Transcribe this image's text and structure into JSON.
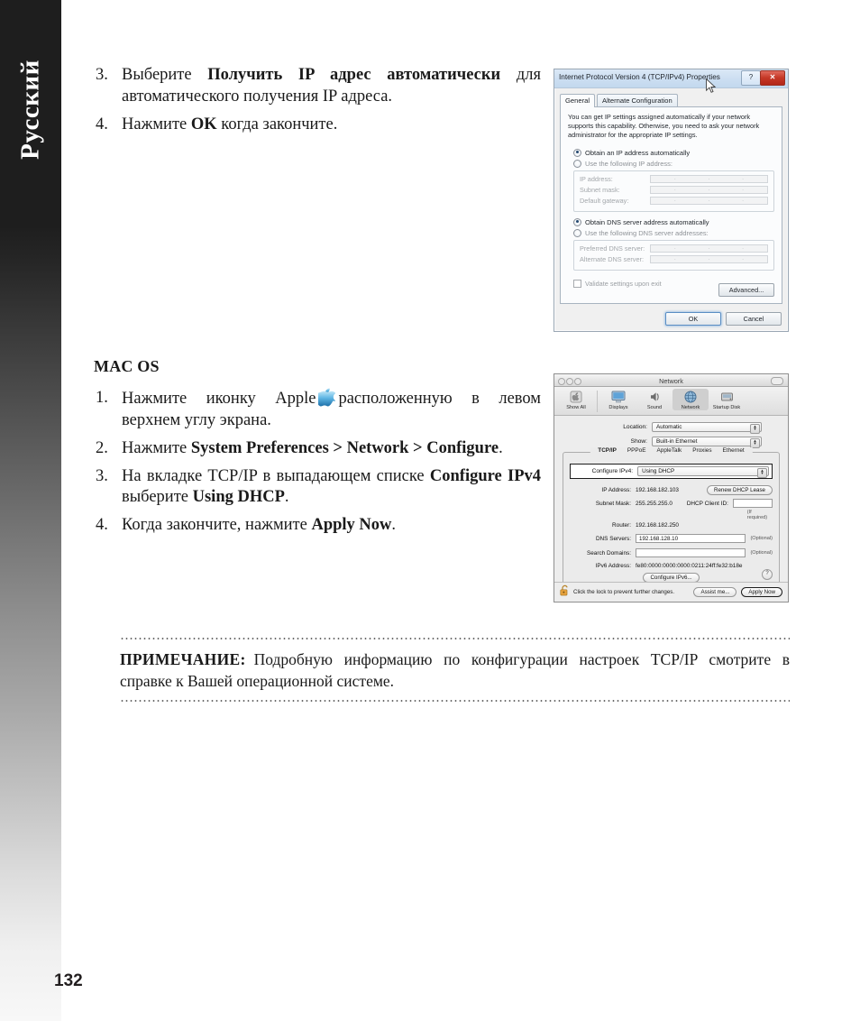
{
  "sidebar": {
    "language_label": "Русский"
  },
  "page": {
    "number": "132"
  },
  "windows_steps": [
    {
      "num": "3.",
      "text_before": "Выберите ",
      "bold": "Получить IP адрес автоматически",
      "text_after": " для автоматического получения IP адреса."
    },
    {
      "num": "4.",
      "text_before": "Нажмите ",
      "bold": "OK",
      "text_after": " когда закончите."
    }
  ],
  "mac_section": {
    "heading": "MAC OS",
    "steps": [
      {
        "num": "1.",
        "part1": "Нажмите иконку Apple",
        "icon": "apple-icon",
        "part2": "расположенную в левом верхнем углу экрана."
      },
      {
        "num": "2.",
        "part1": "Нажмите ",
        "bold": "System Preferences > Network > Configure",
        "part2": "."
      },
      {
        "num": "3.",
        "part1": "На вкладке TCP/IP в выпадающем списке ",
        "bold": "Configure IPv4",
        "part2": " выберите ",
        "bold2": "Using DHCP",
        "part3": "."
      },
      {
        "num": "4.",
        "part1": "Когда закончите, нажмите ",
        "bold": "Apply Now",
        "part2": "."
      }
    ]
  },
  "note": {
    "lead": "ПРИМЕЧАНИЕ:",
    "body": "Подробную информацию по конфигурации настроек TCP/IP смотрите в справке к Вашей операционной системе."
  },
  "windows_dialog": {
    "title": "Internet Protocol Version 4 (TCP/IPv4) Properties",
    "help_button": "?",
    "close_button": "✕",
    "tabs": [
      {
        "label": "General",
        "active": true
      },
      {
        "label": "Alternate Configuration",
        "active": false
      }
    ],
    "intro": "You can get IP settings assigned automatically if your network supports this capability. Otherwise, you need to ask your network administrator for the appropriate IP settings.",
    "radio_obtain_ip": "Obtain an IP address automatically",
    "radio_use_ip": "Use the following IP address:",
    "ip_fields": [
      {
        "label": "IP address:",
        "value": ""
      },
      {
        "label": "Subnet mask:",
        "value": ""
      },
      {
        "label": "Default gateway:",
        "value": ""
      }
    ],
    "radio_obtain_dns": "Obtain DNS server address automatically",
    "radio_use_dns": "Use the following DNS server addresses:",
    "dns_fields": [
      {
        "label": "Preferred DNS server:",
        "value": ""
      },
      {
        "label": "Alternate DNS server:",
        "value": ""
      }
    ],
    "validate_checkbox": "Validate settings upon exit",
    "advanced_button": "Advanced...",
    "ok_button": "OK",
    "cancel_button": "Cancel"
  },
  "mac_dialog": {
    "window_title": "Network",
    "toolbar": [
      {
        "label": "Show All",
        "icon": "show-all-icon",
        "selected": false
      },
      {
        "label": "Displays",
        "icon": "displays-icon",
        "selected": false
      },
      {
        "label": "Sound",
        "icon": "sound-icon",
        "selected": false
      },
      {
        "label": "Network",
        "icon": "network-globe-icon",
        "selected": true
      },
      {
        "label": "Startup Disk",
        "icon": "startup-disk-icon",
        "selected": false
      }
    ],
    "location_label": "Location:",
    "location_value": "Automatic",
    "show_label": "Show:",
    "show_value": "Built-in Ethernet",
    "tabs": [
      {
        "label": "TCP/IP",
        "active": true
      },
      {
        "label": "PPPoE",
        "active": false
      },
      {
        "label": "AppleTalk",
        "active": false
      },
      {
        "label": "Proxies",
        "active": false
      },
      {
        "label": "Ethernet",
        "active": false
      }
    ],
    "configure_ipv4_label": "Configure IPv4:",
    "configure_ipv4_value": "Using DHCP",
    "ip_address_label": "IP Address:",
    "ip_address_value": "192.168.182.103",
    "renew_button": "Renew DHCP Lease",
    "subnet_mask_label": "Subnet Mask:",
    "subnet_mask_value": "255.255.255.0",
    "dhcp_client_id_label": "DHCP Client ID:",
    "dhcp_client_id_value": "",
    "if_required": "(If required)",
    "router_label": "Router:",
    "router_value": "192.168.182.250",
    "dns_servers_label": "DNS Servers:",
    "dns_servers_value": "192.168.128.10",
    "dns_optional": "(Optional)",
    "search_domains_label": "Search Domains:",
    "search_domains_value": "",
    "search_optional": "(Optional)",
    "ipv6_label": "IPv6 Address:",
    "ipv6_value": "fe80:0000:0000:0000:0211:24ff:fe32:b18e",
    "configure_ipv6_button": "Configure IPv6...",
    "help_button": "?",
    "lock_text": "Click the lock to prevent further changes.",
    "assist_button": "Assist me...",
    "apply_button": "Apply Now"
  }
}
